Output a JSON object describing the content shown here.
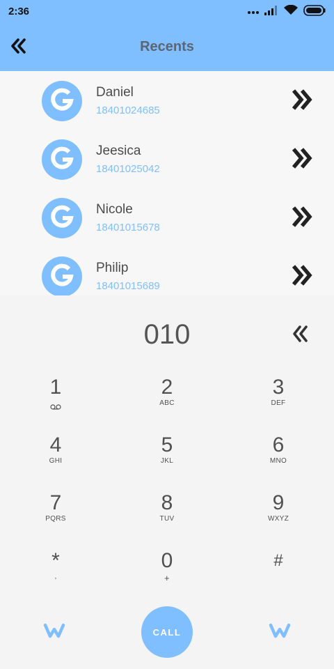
{
  "status_bar": {
    "time": "2:36",
    "icons": [
      "more-dots-icon",
      "signal-icon",
      "wifi-icon",
      "battery-icon"
    ]
  },
  "app_bar": {
    "title": "Recents",
    "back_icon": "double-chevron-left-icon"
  },
  "recents": [
    {
      "name": "Daniel",
      "number": "18401024685"
    },
    {
      "name": "Jeesica",
      "number": "18401025042"
    },
    {
      "name": "Nicole",
      "number": "18401015678"
    },
    {
      "name": "Philip",
      "number": "18401015689"
    }
  ],
  "display": {
    "number": "010",
    "delete_icon": "double-chevron-left-icon"
  },
  "keypad": [
    {
      "digit": "1",
      "letters": ""
    },
    {
      "digit": "2",
      "letters": "ABC"
    },
    {
      "digit": "3",
      "letters": "DEF"
    },
    {
      "digit": "4",
      "letters": "GHI"
    },
    {
      "digit": "5",
      "letters": "JKL"
    },
    {
      "digit": "6",
      "letters": "MNO"
    },
    {
      "digit": "7",
      "letters": "PQRS"
    },
    {
      "digit": "8",
      "letters": "TUV"
    },
    {
      "digit": "9",
      "letters": "WXYZ"
    },
    {
      "digit": "*",
      "letters": ","
    },
    {
      "digit": "0",
      "letters": "+"
    },
    {
      "digit": "#",
      "letters": ""
    }
  ],
  "bottom": {
    "call_label": "CALL",
    "left_icon": "w-logo-icon",
    "right_icon": "w-logo-icon"
  },
  "colors": {
    "accent": "#7fbfff",
    "text": "#555555",
    "background": "#f4f4f4"
  }
}
